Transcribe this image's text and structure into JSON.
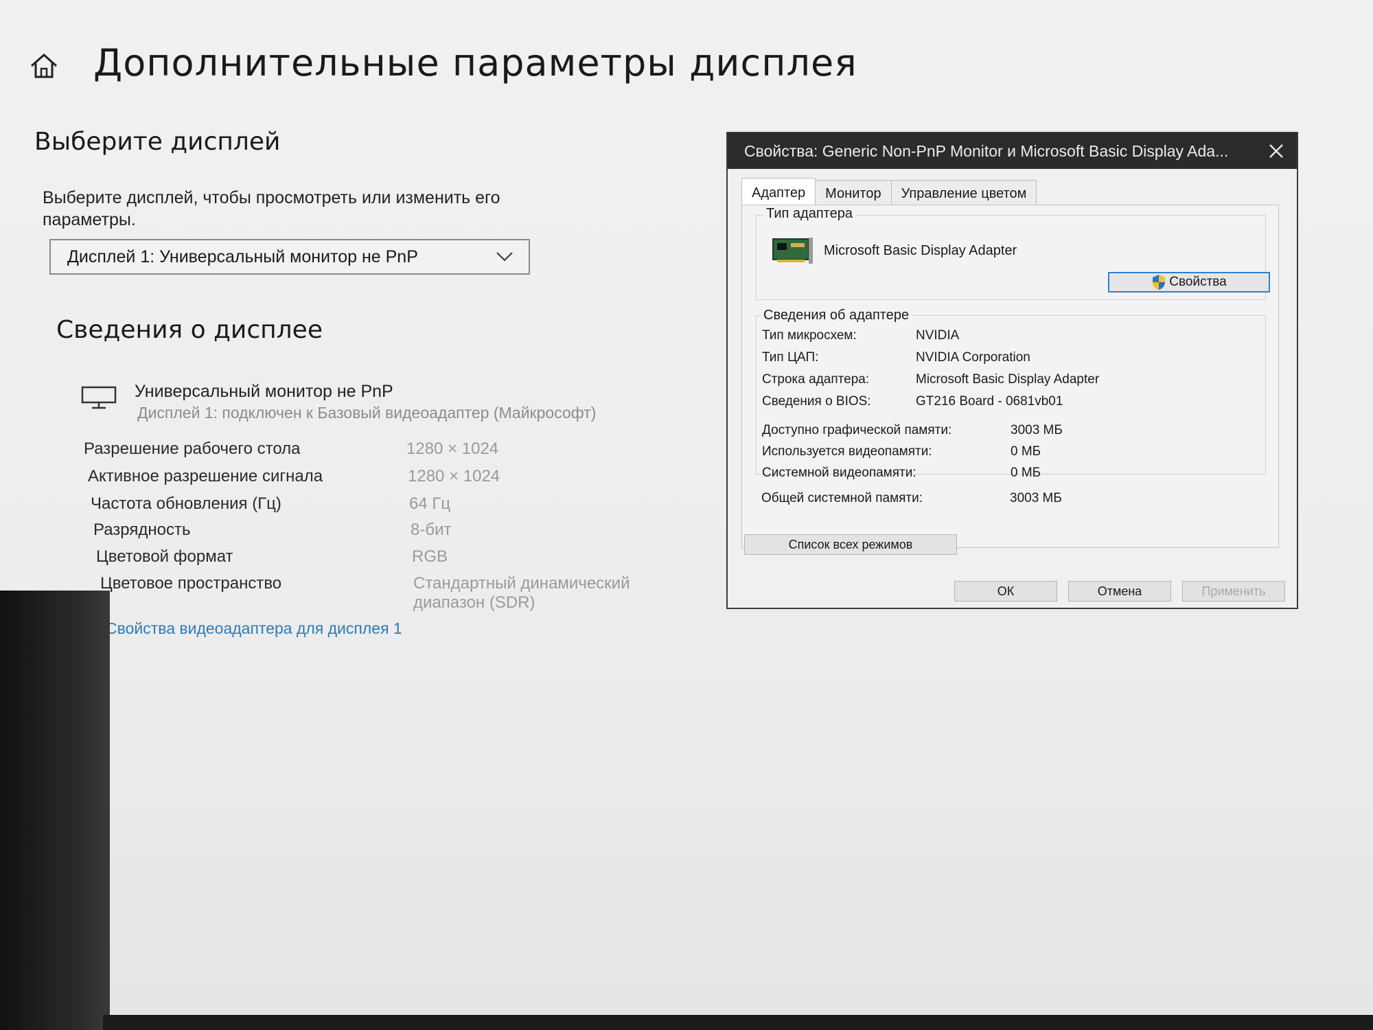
{
  "settings": {
    "title": "Дополнительные параметры дисплея",
    "select_display_heading": "Выберите дисплей",
    "select_display_desc_line1": "Выберите дисплей, чтобы просмотреть или изменить его",
    "select_display_desc_line2": "параметры.",
    "display_dropdown_value": "Дисплей 1: Универсальный монитор не PnP",
    "display_info_heading": "Сведения о дисплее",
    "monitor_name": "Универсальный монитор не PnP",
    "monitor_connection": "Дисплей 1: подключен к Базовый видеоадаптер (Майкрософт)",
    "details": [
      {
        "label": "Разрешение рабочего стола",
        "value": "1280 × 1024"
      },
      {
        "label": "Активное разрешение сигнала",
        "value": "1280 × 1024"
      },
      {
        "label": "Частота обновления (Гц)",
        "value": "64 Гц"
      },
      {
        "label": "Разрядность",
        "value": "8-бит"
      },
      {
        "label": "Цветовой формат",
        "value": "RGB"
      },
      {
        "label": "Цветовое пространство",
        "value": "Стандартный динамический",
        "value_line2": "диапазон (SDR)"
      }
    ],
    "adapter_link": "Свойства видеоадаптера для дисплея 1"
  },
  "dialog": {
    "title": "Свойства: Generic Non-PnP Monitor и Microsoft Basic Display Ada...",
    "tabs": [
      "Адаптер",
      "Монитор",
      "Управление цветом"
    ],
    "adapter_type_group": "Тип адаптера",
    "adapter_name": "Microsoft Basic Display Adapter",
    "properties_button": "Свойства",
    "adapter_info_group": "Сведения об адаптере",
    "adapter_info": [
      {
        "label": "Тип микросхем:",
        "value": "NVIDIA"
      },
      {
        "label": "Тип ЦАП:",
        "value": "NVIDIA Corporation"
      },
      {
        "label": "Строка адаптера:",
        "value": "Microsoft Basic Display Adapter"
      },
      {
        "label": "Сведения о BIOS:",
        "value": "GT216 Board - 0681vb01"
      }
    ],
    "memory_info": [
      {
        "label": "Доступно графической памяти:",
        "value": "3003 МБ"
      },
      {
        "label": "Используется видеопамяти:",
        "value": "0 МБ"
      },
      {
        "label": "Системной видеопамяти:",
        "value": "0 МБ"
      },
      {
        "label": "Общей системной памяти:",
        "value": "3003 МБ"
      }
    ],
    "list_modes_button": "Список всех режимов",
    "ok_button": "ОК",
    "cancel_button": "Отмена",
    "apply_button": "Применить"
  }
}
